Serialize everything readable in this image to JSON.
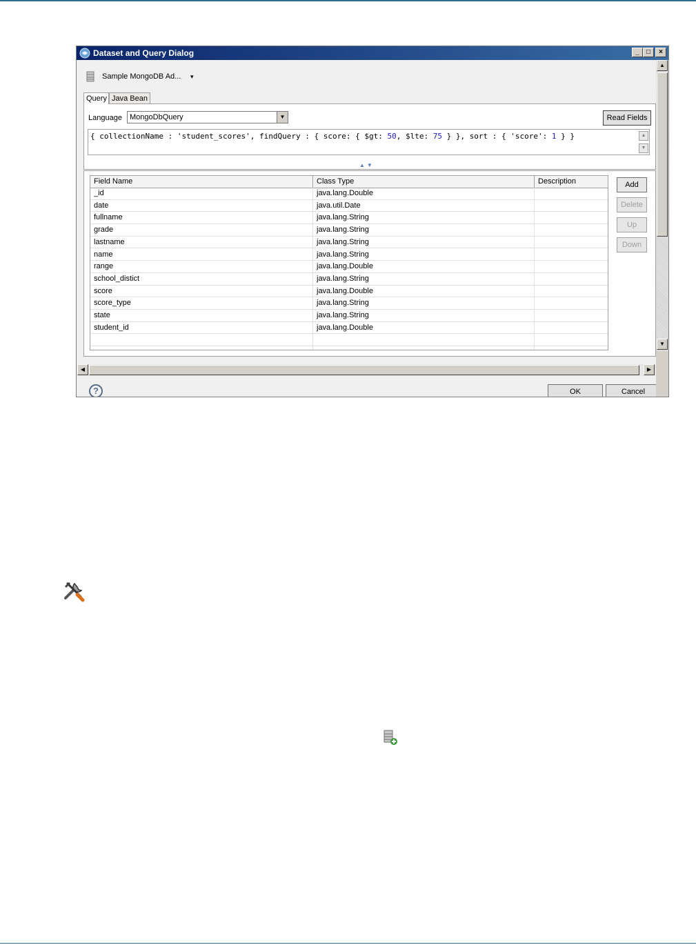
{
  "dialog": {
    "title": "Dataset and Query Dialog",
    "window_buttons": {
      "minimize": "_",
      "maximize": "□",
      "close": "×"
    },
    "data_source": {
      "label": "Sample MongoDB Ad...",
      "dropdown_arrow": "▾"
    },
    "tabs": [
      {
        "label": "Query",
        "active": true
      },
      {
        "label": "Java Bean",
        "active": false
      }
    ],
    "query": {
      "language_label": "Language",
      "language_value": "MongoDbQuery",
      "read_fields_label": "Read Fields",
      "text_parts": [
        "{ collectionName : 'student_scores', findQuery : { score: { $gt: ",
        "50",
        ", $lte: ",
        "75",
        " } }, sort : { 'score': ",
        "1",
        " } }"
      ]
    },
    "fields_table": {
      "columns": [
        "Field Name",
        "Class Type",
        "Description"
      ],
      "rows": [
        [
          "_id",
          "java.lang.Double",
          ""
        ],
        [
          "date",
          "java.util.Date",
          ""
        ],
        [
          "fullname",
          "java.lang.String",
          ""
        ],
        [
          "grade",
          "java.lang.String",
          ""
        ],
        [
          "lastname",
          "java.lang.String",
          ""
        ],
        [
          "name",
          "java.lang.String",
          ""
        ],
        [
          "range",
          "java.lang.Double",
          ""
        ],
        [
          "school_distict",
          "java.lang.String",
          ""
        ],
        [
          "score",
          "java.lang.Double",
          ""
        ],
        [
          "score_type",
          "java.lang.String",
          ""
        ],
        [
          "state",
          "java.lang.String",
          ""
        ],
        [
          "student_id",
          "java.lang.Double",
          ""
        ]
      ]
    },
    "side_buttons": [
      {
        "label": "Add",
        "enabled": true
      },
      {
        "label": "Delete",
        "enabled": false
      },
      {
        "label": "Up",
        "enabled": false
      },
      {
        "label": "Down",
        "enabled": false
      }
    ],
    "help_icon_glyph": "?",
    "ok_label": "OK",
    "cancel_label": "Cancel"
  },
  "colors": {
    "title_bar": "#0a246a",
    "number_literal": "#2020c0",
    "page_rule": "#2d6b8a"
  },
  "icons": [
    "tools-icon",
    "add-data-source-icon"
  ]
}
